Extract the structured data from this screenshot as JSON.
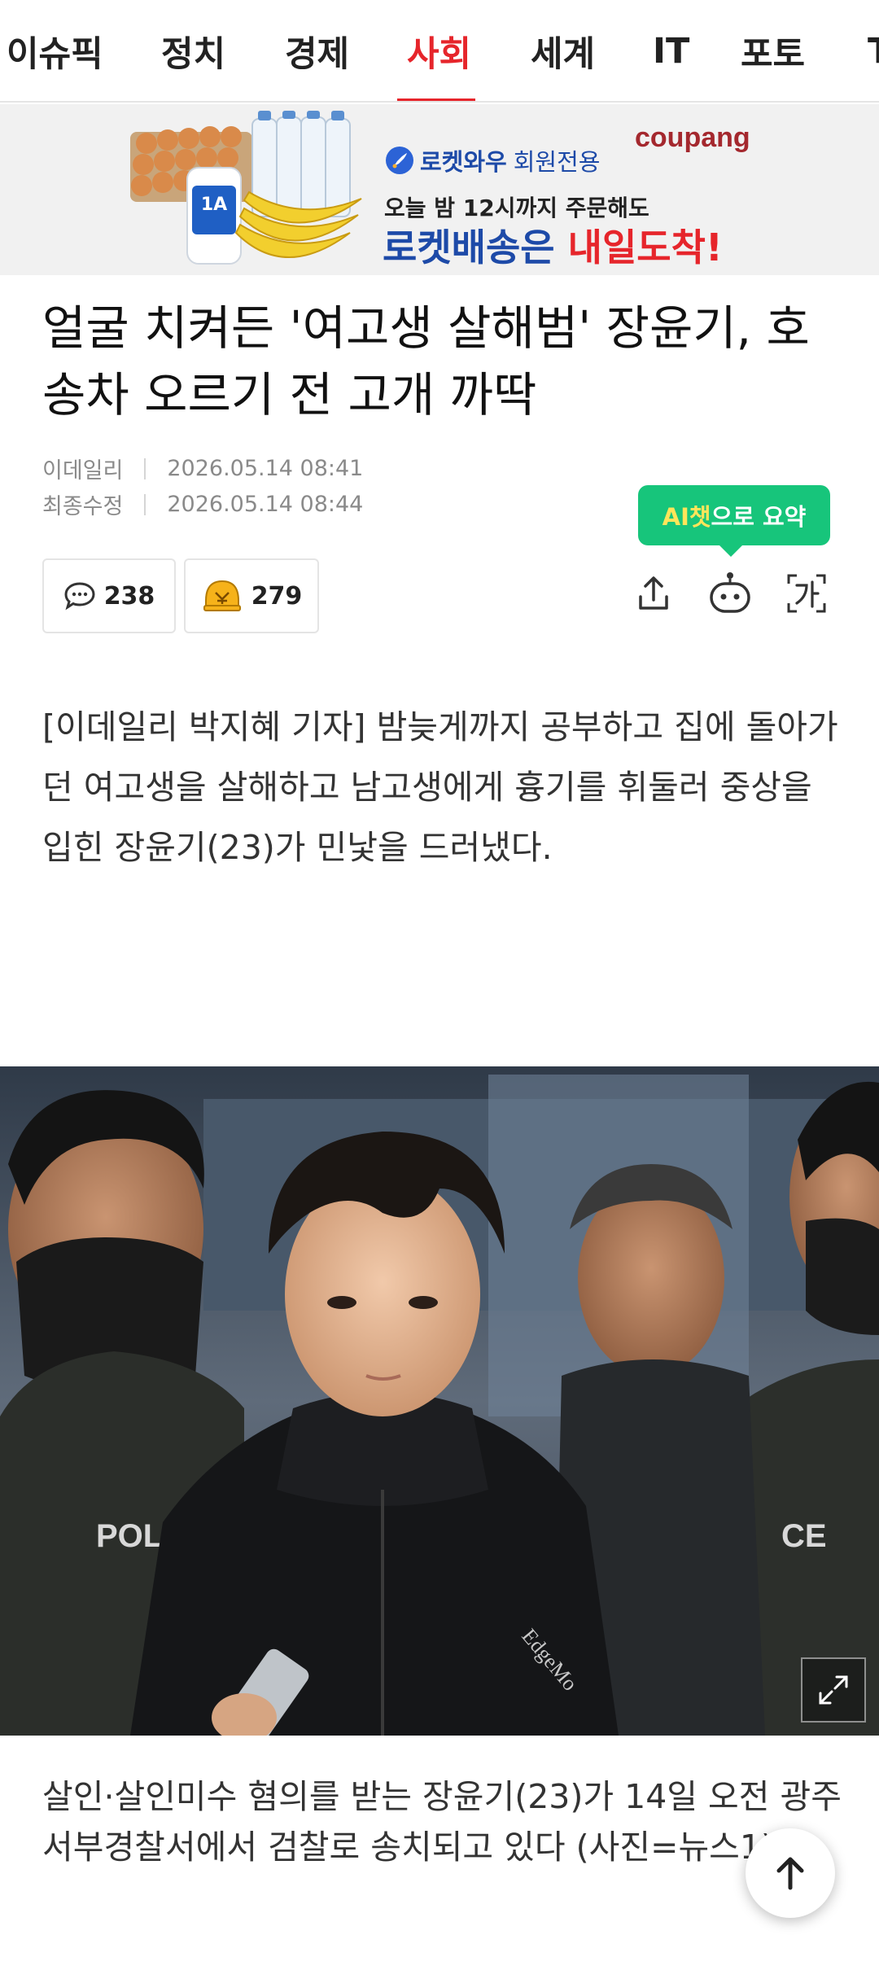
{
  "nav": {
    "items": [
      {
        "label": "이슈픽"
      },
      {
        "label": "정치"
      },
      {
        "label": "경제"
      },
      {
        "label": "사회",
        "active": true
      },
      {
        "label": "세계"
      },
      {
        "label": "IT"
      },
      {
        "label": "포토"
      },
      {
        "label": "T"
      }
    ]
  },
  "ad": {
    "brand": "coupang",
    "line1_a": "로켓와우",
    "line1_b": "회원전용",
    "line2": "오늘 밤 12시까지 주문해도",
    "line3_a": "로켓배송은 ",
    "line3_b": "내일도착!",
    "milk_label": "1A"
  },
  "article": {
    "headline": "얼굴 치켜든 '여고생 살해범' 장윤기, 호송차 오르기 전 고개 까딱",
    "source": "이데일리",
    "published": "2026.05.14 08:41",
    "modified_label": "최종수정",
    "modified": "2026.05.14 08:44",
    "comments": "238",
    "likes": "279",
    "body": "[이데일리 박지혜 기자] 밤늦게까지 공부하고 집에 돌아가던 여고생을 살해하고 남고생에게 흉기를 휘둘러 중상을 입힌 장윤기(23)가 민낯을 드러냈다.",
    "caption": "살인·살인미수 혐의를 받는 장윤기(23)가 14일 오전 광주 서부경찰서에서 검찰로 송치되고 있다 (사진=뉴스1)"
  },
  "ai_summary": {
    "a": "AI챗",
    "b": "으로 요약"
  },
  "photo": {
    "vest_text_left": "POL",
    "vest_text_right": "CE",
    "jacket_text": "EdgeMo"
  },
  "colors": {
    "accent": "#e6252b",
    "ai_green": "#17c57b",
    "rocket_blue": "#1d4aa8"
  },
  "icons": [
    "comment-icon",
    "like-icon",
    "share-icon",
    "ai-bot-icon",
    "font-size-icon",
    "expand-icon",
    "arrow-up-icon",
    "rocket-icon"
  ]
}
